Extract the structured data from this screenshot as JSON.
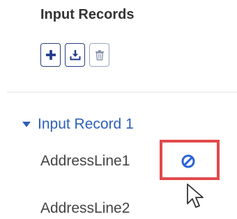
{
  "panel": {
    "title": "Input Records"
  },
  "toolbar": {
    "buttons": [
      {
        "icon": "plus-icon",
        "enabled": true
      },
      {
        "icon": "download-icon",
        "enabled": true
      },
      {
        "icon": "trash-icon",
        "enabled": false
      }
    ]
  },
  "record": {
    "title": "Input Record 1",
    "expanded": true,
    "fields": [
      {
        "label": "AddressLine1",
        "action_icon": "exclude-icon"
      },
      {
        "label": "AddressLine2"
      }
    ]
  },
  "colors": {
    "title_text": "#333333",
    "button_border": "#2a3e80",
    "button_icon": "#1f3a8a",
    "record_link": "#2f5fb8",
    "exclude_icon": "#2b63d6",
    "highlight": "#e14a4a"
  }
}
